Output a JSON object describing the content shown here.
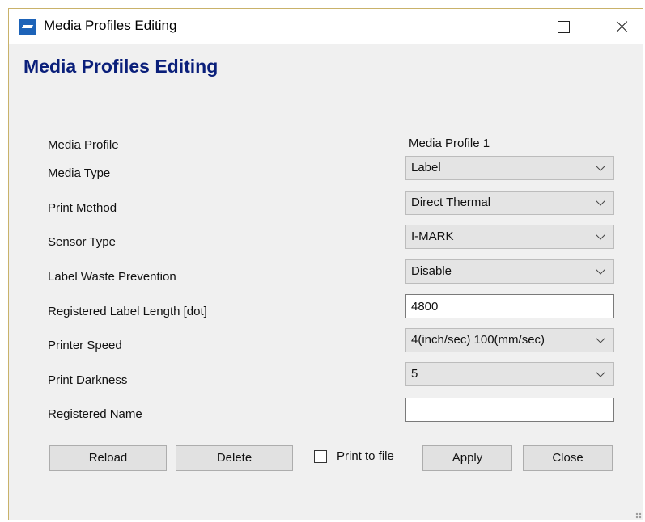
{
  "window": {
    "title": "Media Profiles Editing",
    "controls": {
      "minimize": "minimize",
      "maximize": "maximize",
      "close": "close"
    }
  },
  "page_title": "Media Profiles Editing",
  "form": {
    "media_profile": {
      "label": "Media Profile",
      "value": "Media Profile 1"
    },
    "media_type": {
      "label": "Media Type",
      "value": "Label"
    },
    "print_method": {
      "label": "Print Method",
      "value": "Direct Thermal"
    },
    "sensor_type": {
      "label": "Sensor Type",
      "value": "I-MARK"
    },
    "label_waste_prevention": {
      "label": "Label Waste Prevention",
      "value": "Disable"
    },
    "registered_label_length": {
      "label": "Registered Label Length [dot]",
      "value": "4800"
    },
    "printer_speed": {
      "label": "Printer Speed",
      "value": "4(inch/sec) 100(mm/sec)"
    },
    "print_darkness": {
      "label": "Print Darkness",
      "value": "5"
    },
    "registered_name": {
      "label": "Registered Name",
      "value": ""
    }
  },
  "buttons": {
    "reload": "Reload",
    "delete": "Delete",
    "apply": "Apply",
    "close": "Close"
  },
  "print_to_file": {
    "label": "Print to file",
    "checked": false
  },
  "icons": {
    "app": "app-icon",
    "dropdown": "chevron-down-icon",
    "resize": "resize-grip-icon"
  },
  "colors": {
    "title_text": "#0a1f7a",
    "window_bg": "#f0f0f0",
    "app_icon": "#1d63b8"
  }
}
